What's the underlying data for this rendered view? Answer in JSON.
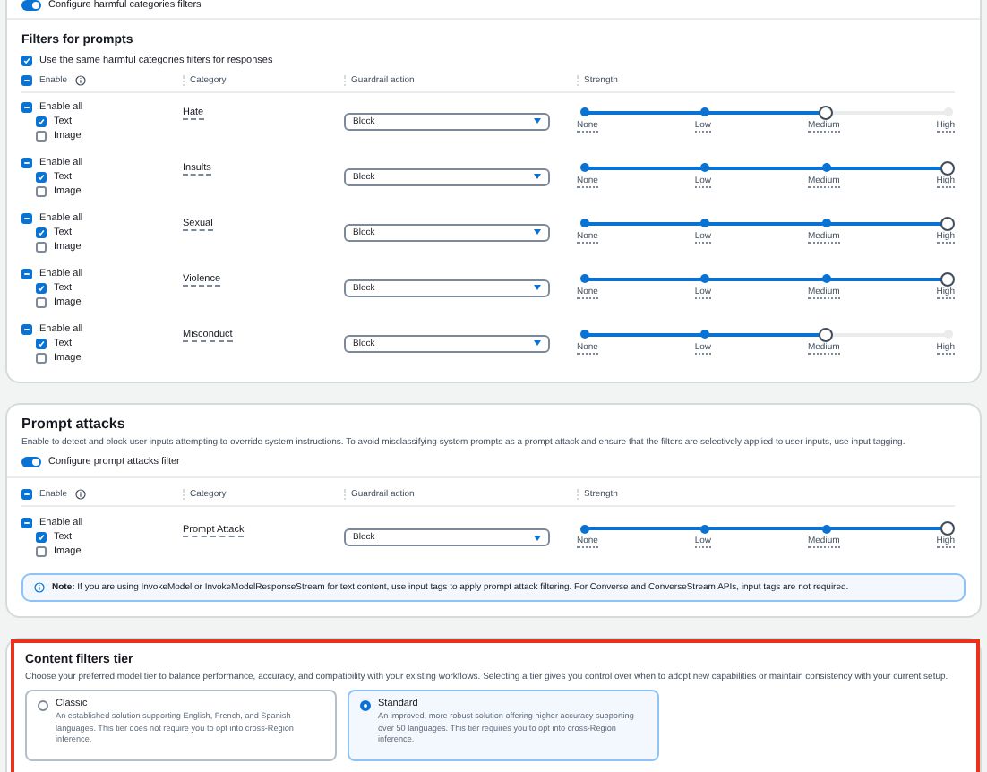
{
  "harmful_toggle": {
    "label": "Configure harmful categories filters",
    "on": true
  },
  "filters_for_prompts": {
    "title": "Filters for prompts",
    "same_filters": {
      "label": "Use the same harmful categories filters for responses",
      "checked": true
    },
    "columns": [
      "Enable",
      "Category",
      "Guardrail action",
      "Strength"
    ],
    "header_indeterminate": true,
    "rows": [
      {
        "enable_all": "Enable all",
        "indeterminate": true,
        "options": [
          {
            "label": "Text",
            "checked": true
          },
          {
            "label": "Image",
            "checked": false
          }
        ],
        "category": "Hate",
        "action": "Block",
        "level": 0.667,
        "ticks": [
          "None",
          "Low",
          "Medium",
          "High"
        ]
      },
      {
        "enable_all": "Enable all",
        "indeterminate": true,
        "options": [
          {
            "label": "Text",
            "checked": true
          },
          {
            "label": "Image",
            "checked": false
          }
        ],
        "category": "Insults",
        "action": "Block",
        "level": 1,
        "ticks": [
          "None",
          "Low",
          "Medium",
          "High"
        ]
      },
      {
        "enable_all": "Enable all",
        "indeterminate": true,
        "options": [
          {
            "label": "Text",
            "checked": true
          },
          {
            "label": "Image",
            "checked": false
          }
        ],
        "category": "Sexual",
        "action": "Block",
        "level": 1,
        "ticks": [
          "None",
          "Low",
          "Medium",
          "High"
        ]
      },
      {
        "enable_all": "Enable all",
        "indeterminate": true,
        "options": [
          {
            "label": "Text",
            "checked": true
          },
          {
            "label": "Image",
            "checked": false
          }
        ],
        "category": "Violence",
        "action": "Block",
        "level": 1,
        "ticks": [
          "None",
          "Low",
          "Medium",
          "High"
        ]
      },
      {
        "enable_all": "Enable all",
        "indeterminate": true,
        "options": [
          {
            "label": "Text",
            "checked": true
          },
          {
            "label": "Image",
            "checked": false
          }
        ],
        "category": "Misconduct",
        "action": "Block",
        "level": 0.667,
        "ticks": [
          "None",
          "Low",
          "Medium",
          "High"
        ]
      }
    ]
  },
  "prompt_attacks": {
    "title": "Prompt attacks",
    "description": "Enable to detect and block user inputs attempting to override system instructions. To avoid misclassifying system prompts as a prompt attack and ensure that the filters are selectively applied to user inputs, use input tagging.",
    "toggle": {
      "label": "Configure prompt attacks filter",
      "on": true
    },
    "columns": [
      "Enable",
      "Category",
      "Guardrail action",
      "Strength"
    ],
    "header_indeterminate": true,
    "rows": [
      {
        "enable_all": "Enable all",
        "indeterminate": true,
        "options": [
          {
            "label": "Text",
            "checked": true
          },
          {
            "label": "Image",
            "checked": false
          }
        ],
        "category": "Prompt Attack",
        "action": "Block",
        "level": 1,
        "ticks": [
          "None",
          "Low",
          "Medium",
          "High"
        ]
      }
    ],
    "note": "**Note:** If you are using InvokeModel or InvokeModelResponseStream for text content, use input tags to apply prompt attack filtering. For Converse and ConverseStream APIs, input tags are not required."
  },
  "content_filters_tier": {
    "title": "Content filters tier",
    "highlighted": true,
    "description": "Choose your preferred model tier to balance performance, accuracy, and compatibility with your existing workflows. Selecting a tier gives you control over when to adopt new capabilities or maintain consistency with your current setup.",
    "options": [
      {
        "title": "Classic",
        "description": "An established solution supporting English, French, and Spanish languages. This tier does not require you to opt into cross-Region inference.",
        "selected": false
      },
      {
        "title": "Standard",
        "description": "An improved, more robust solution offering higher accuracy supporting over 50 languages. This tier requires you to opt into cross-Region inference.",
        "selected": true
      }
    ]
  }
}
